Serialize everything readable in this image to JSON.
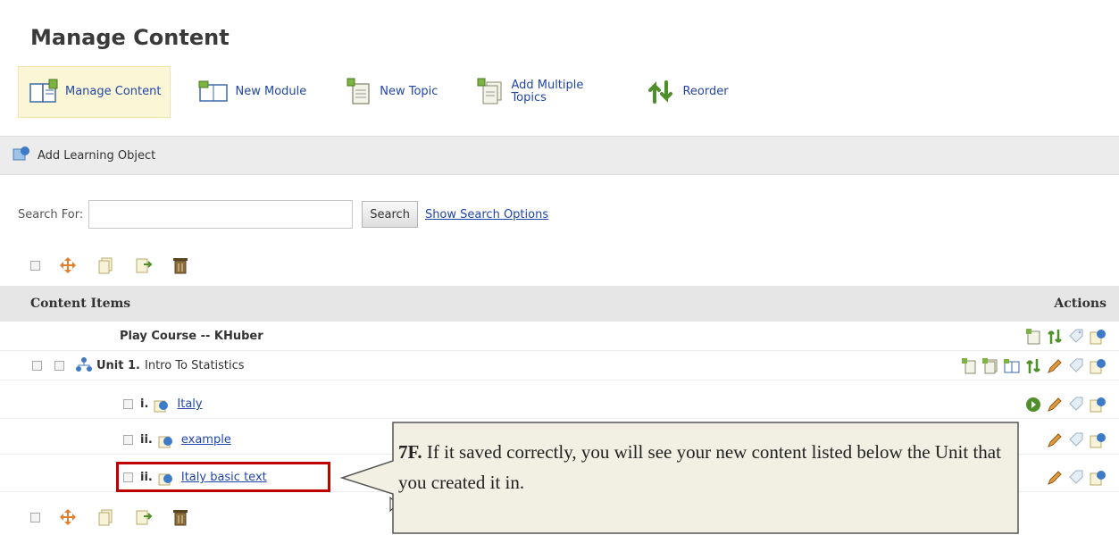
{
  "page": {
    "title": "Manage Content"
  },
  "toolbar": {
    "items": [
      {
        "label": "Manage Content",
        "icon": "book-icon",
        "active": true
      },
      {
        "label": "New Module",
        "icon": "book-open-icon"
      },
      {
        "label": "New Topic",
        "icon": "topic-icon"
      },
      {
        "label": "Add Multiple Topics",
        "icon": "multiple-topics-icon"
      },
      {
        "label": "Reorder",
        "icon": "reorder-icon"
      }
    ]
  },
  "action_bar": {
    "label": "Add Learning Object"
  },
  "search": {
    "label": "Search For:",
    "value": "",
    "button": "Search",
    "options_link": "Show Search Options"
  },
  "table": {
    "header_left": "Content Items",
    "header_right": "Actions",
    "rows": [
      {
        "text": "Play Course -- KHuber"
      },
      {
        "num": "Unit 1.",
        "text": "Intro To Statistics"
      },
      {
        "num": "i.",
        "link": "Italy"
      },
      {
        "num": "ii.",
        "link": "example"
      },
      {
        "num": "ii.",
        "link": "Italy basic text"
      }
    ]
  },
  "callout": {
    "step": "7F.",
    "text": "If it saved correctly, you will see your new content listed below the Unit that you created it in."
  },
  "colors": {
    "link": "#2246a8",
    "highlight": "#c00000",
    "callout_bg": "#f2f0e3"
  }
}
